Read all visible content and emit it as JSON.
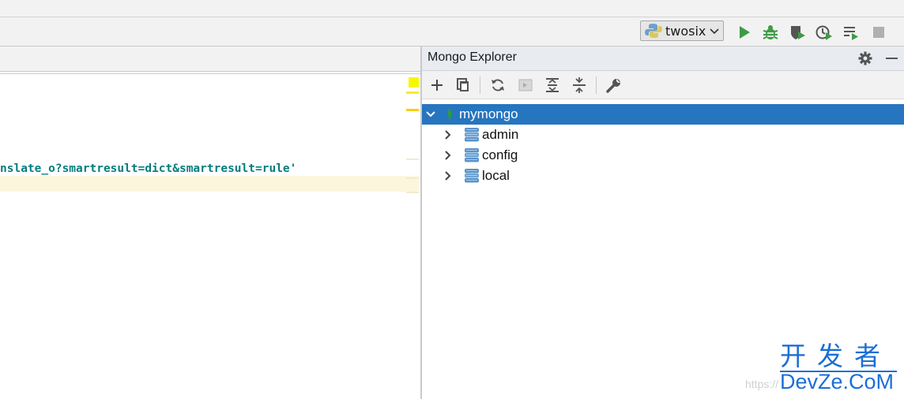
{
  "toolbar": {
    "run_config": "twosix",
    "icons": [
      "python-icon",
      "chevron-down-icon",
      "run-icon",
      "debug-icon",
      "coverage-icon",
      "profile-icon",
      "run-list-icon",
      "stop-icon"
    ],
    "colors": {
      "run": "#3e9b45",
      "debug": "#3e9b45",
      "stop": "#b0b0b0"
    }
  },
  "editor": {
    "code_line": "nslate_o?smartresult=dict&smartresult=rule'",
    "colors": {
      "string": "#067d7d",
      "caret_line": "#fcf6dc",
      "marker": "#f7f700"
    }
  },
  "explorer": {
    "title": "Mongo Explorer",
    "toolbar_icons": [
      "add-icon",
      "copy-icon",
      "refresh-icon",
      "console-icon",
      "expand-all-icon",
      "collapse-all-icon",
      "settings-wrench-icon"
    ],
    "tree": {
      "root": {
        "label": "mymongo",
        "expanded": true,
        "selected": true
      },
      "children": [
        {
          "label": "admin",
          "expanded": false
        },
        {
          "label": "config",
          "expanded": false
        },
        {
          "label": "local",
          "expanded": false
        }
      ]
    },
    "colors": {
      "selected_row": "#2675bf",
      "leaf": "#2e9b3a",
      "database": "#5b93c8"
    }
  },
  "watermark": {
    "url_text": "https://",
    "brand_cn": "开发者",
    "brand_en": "DevZe.CoM"
  }
}
